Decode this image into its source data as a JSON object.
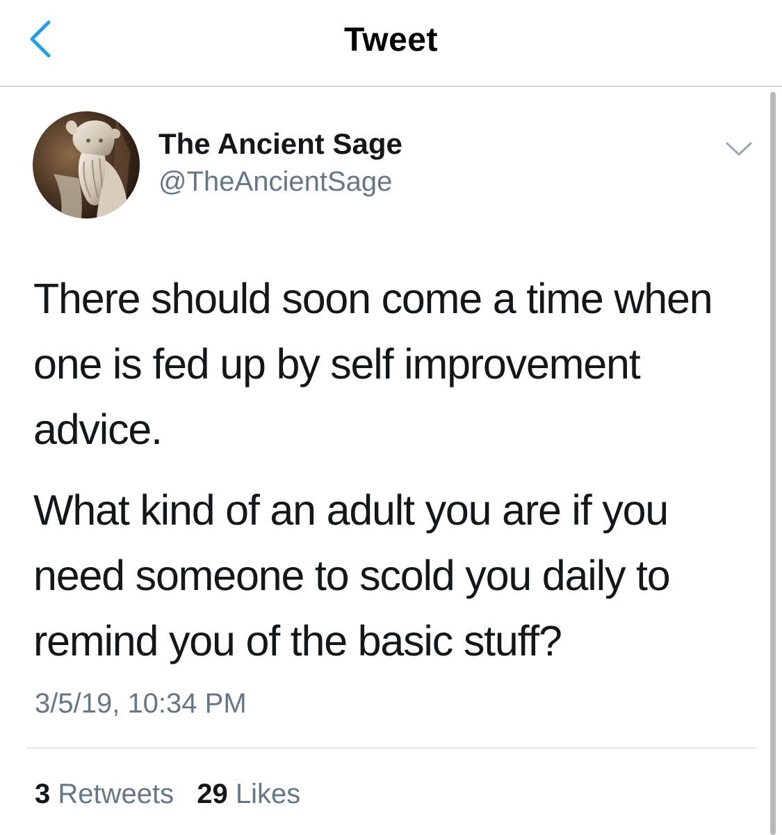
{
  "nav": {
    "title": "Tweet",
    "back_icon": "chevron-left-icon"
  },
  "colors": {
    "accent": "#1da1f2",
    "text_primary": "#14171a",
    "text_secondary": "#657786",
    "divider": "#e1e8ed"
  },
  "tweet": {
    "author": {
      "display_name": "The Ancient Sage",
      "handle": "@TheAncientSage"
    },
    "menu_icon": "chevron-down-icon",
    "lines": [
      "There should soon come a time when",
      "one is fed up by self improvement",
      "advice.",
      "What kind of an adult you are if you",
      "need someone to scold you daily to",
      "remind you of the basic stuff?"
    ],
    "timestamp": "3/5/19, 10:34 PM",
    "stats": {
      "retweets_count": "3",
      "retweets_label": "Retweets",
      "likes_count": "29",
      "likes_label": "Likes"
    }
  }
}
